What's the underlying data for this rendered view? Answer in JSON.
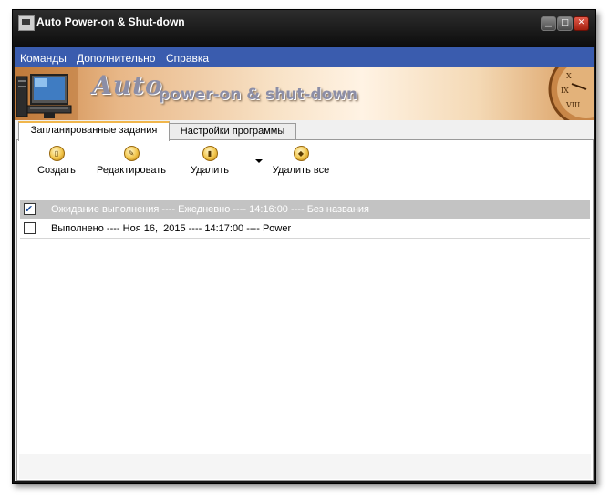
{
  "window": {
    "title": "Auto Power-on & Shut-down"
  },
  "menu": [
    "Команды",
    "Дополнительно",
    "Справка"
  ],
  "banner": {
    "title_part1": "Auto",
    "title_part2": "power-on & shut-down"
  },
  "tabs": [
    {
      "label": "Запланированные задания",
      "active": true
    },
    {
      "label": "Настройки программы",
      "active": false
    }
  ],
  "toolbar": {
    "create": "Создать",
    "edit": "Редактировать",
    "delete": "Удалить",
    "delete_all": "Удалить все"
  },
  "tasks": [
    {
      "checked": true,
      "text": "Ожидание выполнения ---- Ежедневно ---- 14:16:00 ---- Без названия",
      "selected": true
    },
    {
      "checked": false,
      "text": "Выполнено ---- Ноя 16,  2015 ---- 14:17:00 ---- Power",
      "selected": false
    }
  ],
  "colors": {
    "menubar": "#3a5cae",
    "titlebar": "#161616",
    "selected_row": "#c3c3c3"
  },
  "icons": {
    "create": "create-icon",
    "edit": "edit-icon",
    "delete": "delete-icon",
    "delete_all": "eraser-icon"
  }
}
